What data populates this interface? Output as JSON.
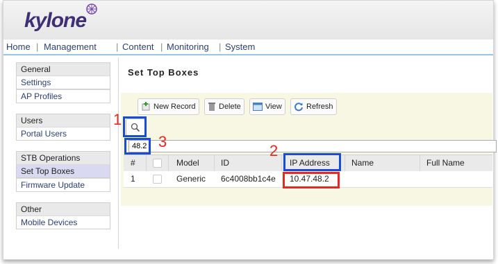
{
  "app": {
    "logo_text": "kylone"
  },
  "menu": {
    "items": [
      "Home",
      "Management",
      "Content",
      "Monitoring",
      "System"
    ],
    "separator": "|"
  },
  "sidebar": {
    "groups": [
      {
        "title": "General",
        "items": [
          "Settings",
          "AP Profiles"
        ]
      },
      {
        "title": "Users",
        "items": [
          "Portal Users"
        ]
      },
      {
        "title": "STB Operations",
        "items": [
          "Set Top Boxes",
          "Firmware Update"
        ],
        "selected": "Set Top Boxes"
      },
      {
        "title": "Other",
        "items": [
          "Mobile Devices"
        ]
      }
    ]
  },
  "main": {
    "title": "Set Top Boxes",
    "toolbar": {
      "new_record": "New Record",
      "delete": "Delete",
      "view": "View",
      "refresh": "Refresh"
    },
    "filter": {
      "value": "48.2"
    },
    "table": {
      "headers": [
        "#",
        "",
        "Model",
        "ID",
        "IP Address",
        "Name",
        "Full Name"
      ],
      "rows": [
        {
          "num": "1",
          "model": "Generic",
          "id": "6c4008bb1c4e",
          "ip": "10.47.48.2",
          "name": "",
          "full_name": ""
        }
      ]
    }
  },
  "annotations": {
    "labels": [
      "1",
      "2",
      "3"
    ],
    "colors": {
      "blue": "#1a4bd8",
      "red": "#e8281e"
    }
  },
  "colors": {
    "brand": "#3f2f76",
    "link": "#2b3f78",
    "panel": "#f7f7e3",
    "selected": "#d9d9f2"
  }
}
